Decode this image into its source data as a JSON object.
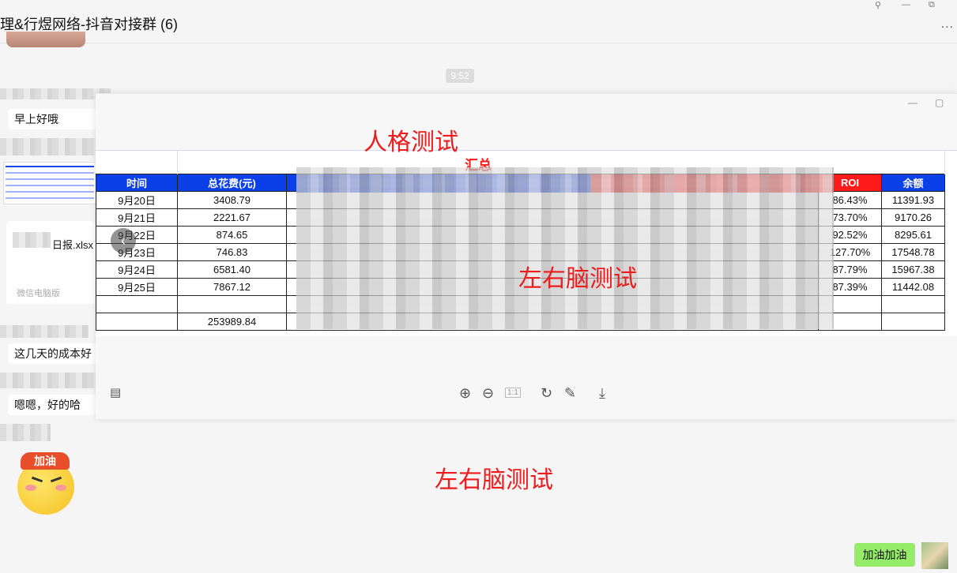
{
  "window": {
    "title": "理&行煜网络-抖音对接群 (6)",
    "pin_icon": "pin-icon",
    "minimize": "—",
    "restore": "⧉",
    "more": "..."
  },
  "chat": {
    "time": "9:52",
    "messages": [
      {
        "text": "早上好哦"
      },
      {
        "file_name": "日报.xlsx",
        "source": "微信电脑版"
      },
      {
        "text": "这几天的成本好"
      },
      {
        "text": "嗯嗯，好的哈"
      }
    ],
    "sticker_text": "加油",
    "my_message": "加油加油"
  },
  "viewer": {
    "watermark_top": "人格测试",
    "watermark_mid": "左右脑测试",
    "watermark_bottom": "左右脑测试",
    "page_indicator": "1:1",
    "min": "—",
    "max": "▢"
  },
  "sheet": {
    "summary_title": "汇总",
    "headers": {
      "date": "时间",
      "spend": "总花费(元)",
      "roi": "ROI",
      "balance": "余额"
    },
    "rows": [
      {
        "date": "9月20日",
        "spend": "3408.79",
        "roi": "86.43%",
        "balance": "11391.93"
      },
      {
        "date": "9月21日",
        "spend": "2221.67",
        "roi": "73.70%",
        "balance": "9170.26"
      },
      {
        "date": "9月22日",
        "spend": "874.65",
        "roi": "92.52%",
        "balance": "8295.61"
      },
      {
        "date": "9月23日",
        "spend": "746.83",
        "roi": "127.70%",
        "balance": "17548.78"
      },
      {
        "date": "9月24日",
        "spend": "6581.40",
        "roi": "87.79%",
        "balance": "15967.38"
      },
      {
        "date": "9月25日",
        "spend": "7867.12",
        "roi": "87.39%",
        "balance": "11442.08"
      }
    ],
    "total_spend": "253989.84"
  },
  "icons": [
    "zoom-in-icon",
    "zoom-out-icon",
    "actual-size-icon",
    "rotate-icon",
    "edit-icon",
    "download-icon"
  ]
}
